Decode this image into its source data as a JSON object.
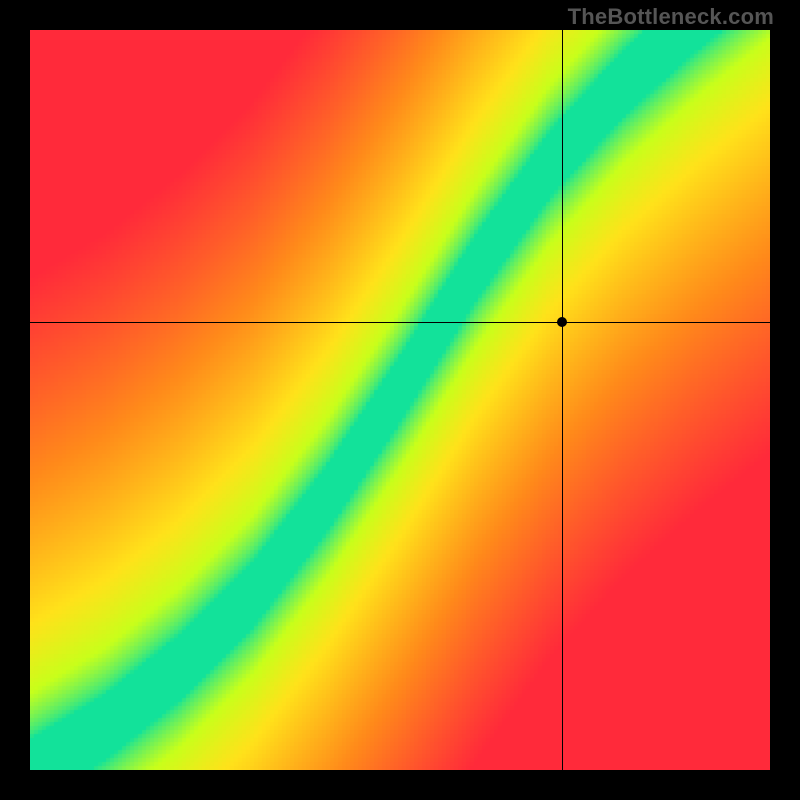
{
  "branding": {
    "text": "TheBottleneck.com"
  },
  "colors": {
    "red": "#ff2a3a",
    "orange": "#ff8a1a",
    "yellow": "#ffe21a",
    "yellowgreen": "#c8ff1a",
    "green": "#12e29a",
    "black": "#000000"
  },
  "layout": {
    "canvas_size": 740,
    "plot_left": 30,
    "plot_top": 30,
    "pixel_step": 4
  },
  "chart_data": {
    "type": "heatmap",
    "title": "",
    "xlabel": "",
    "ylabel": "",
    "xlim": [
      0,
      1
    ],
    "ylim": [
      0,
      1
    ],
    "crosshair": {
      "x": 0.72,
      "y": 0.605
    },
    "ideal_curve": {
      "description": "Green ideal ridge as y vs x control points (normalized 0..1, origin bottom-left). Between points the curve is linear.",
      "points": [
        {
          "x": 0.0,
          "y": 0.0
        },
        {
          "x": 0.1,
          "y": 0.06
        },
        {
          "x": 0.2,
          "y": 0.14
        },
        {
          "x": 0.3,
          "y": 0.24
        },
        {
          "x": 0.4,
          "y": 0.37
        },
        {
          "x": 0.5,
          "y": 0.52
        },
        {
          "x": 0.6,
          "y": 0.68
        },
        {
          "x": 0.7,
          "y": 0.82
        },
        {
          "x": 0.8,
          "y": 0.93
        },
        {
          "x": 0.9,
          "y": 1.02
        },
        {
          "x": 1.0,
          "y": 1.1
        }
      ]
    },
    "band_half_width": 0.045,
    "falloff": 1.6,
    "series": [
      {
        "name": "marker",
        "values": [
          {
            "x": 0.72,
            "y": 0.605,
            "label": ""
          }
        ]
      }
    ]
  }
}
